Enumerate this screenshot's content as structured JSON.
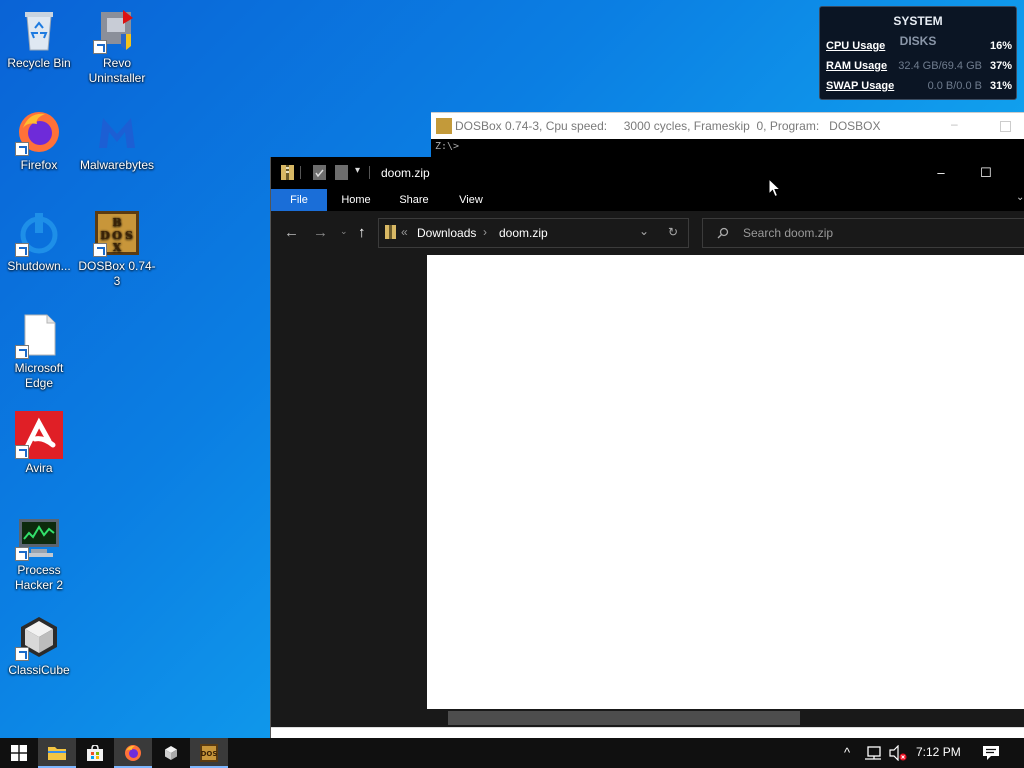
{
  "desktop": {
    "icons": [
      {
        "label": "Recycle Bin",
        "icon": "recycle-bin-icon"
      },
      {
        "label": "Revo Uninstaller",
        "icon": "revo-uninstaller-icon"
      },
      {
        "label": "Firefox",
        "icon": "firefox-icon"
      },
      {
        "label": "Malwarebytes",
        "icon": "malwarebytes-icon"
      },
      {
        "label": "Shutdown...",
        "icon": "power-icon"
      },
      {
        "label": "DOSBox 0.74-3",
        "icon": "dosbox-icon"
      },
      {
        "label": "Microsoft Edge",
        "icon": "blank-file-icon"
      },
      {
        "label": "Avira",
        "icon": "avira-icon"
      },
      {
        "label": "Process Hacker 2",
        "icon": "process-hacker-icon"
      },
      {
        "label": "ClassiCube",
        "icon": "classicube-icon"
      }
    ]
  },
  "sysmon": {
    "title": "SYSTEM",
    "subtitle": "DISKS",
    "rows": [
      {
        "label": "CPU Usage",
        "mid": "",
        "value": "16%"
      },
      {
        "label": "RAM Usage",
        "mid": "32.4 GB/69.4 GB",
        "value": "37%"
      },
      {
        "label": "SWAP Usage",
        "mid": "0.0 B/0.0 B",
        "value": "31%"
      }
    ]
  },
  "dosbox": {
    "title": "DOSBox 0.74-3, Cpu speed:     3000 cycles, Frameskip  0, Program:   DOSBOX",
    "screen_text": "Z:\\>"
  },
  "explorer": {
    "title": "doom.zip",
    "minimize": "–",
    "maximize": "☐",
    "tabs": [
      "File",
      "Home",
      "Share",
      "View"
    ],
    "breadcrumb_prefix": "«",
    "breadcrumb": [
      "Downloads",
      "doom.zip"
    ],
    "search_placeholder": "Search doom.zip"
  },
  "taskbar": {
    "time": "7:12 PM",
    "pinned": [
      "file-explorer-icon",
      "store-icon",
      "firefox-icon",
      "classicube-icon",
      "dosbox-icon"
    ]
  },
  "colors": {
    "accent": "#1a6ed8",
    "explorer_bg": "#191919",
    "taskbar_bg": "#101010"
  }
}
